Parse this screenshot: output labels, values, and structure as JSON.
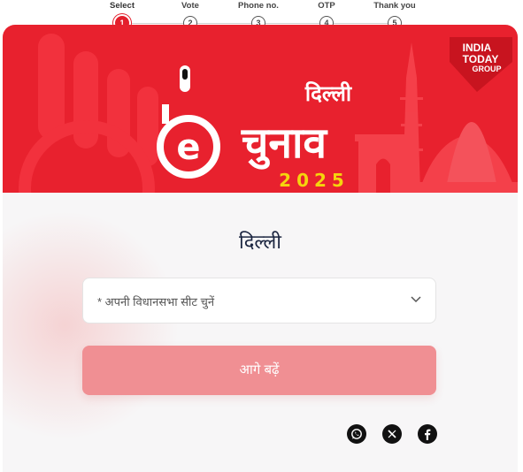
{
  "stepper": {
    "steps": [
      {
        "label": "Select",
        "number": "1",
        "active": true
      },
      {
        "label": "Vote",
        "number": "2",
        "active": false
      },
      {
        "label": "Phone no.",
        "number": "3",
        "active": false
      },
      {
        "label": "OTP",
        "number": "4",
        "active": false
      },
      {
        "label": "Thank you",
        "number": "5",
        "active": false
      }
    ]
  },
  "banner": {
    "city": "दिल्ली",
    "title": "चुनाव",
    "year": "2025",
    "brand_line1": "INDIA",
    "brand_line2": "TODAY",
    "brand_line3": "GROUP",
    "background_color": "#e8212e",
    "year_color": "#f5d40d"
  },
  "form": {
    "title": "दिल्ली",
    "seat_select": {
      "placeholder": "* अपनी विधानसभा सीट चुनें"
    },
    "submit_label": "आगे बढ़ें",
    "submit_color": "#f08f93"
  },
  "share": {
    "icons": [
      "whatsapp-icon",
      "x-icon",
      "facebook-icon"
    ]
  }
}
